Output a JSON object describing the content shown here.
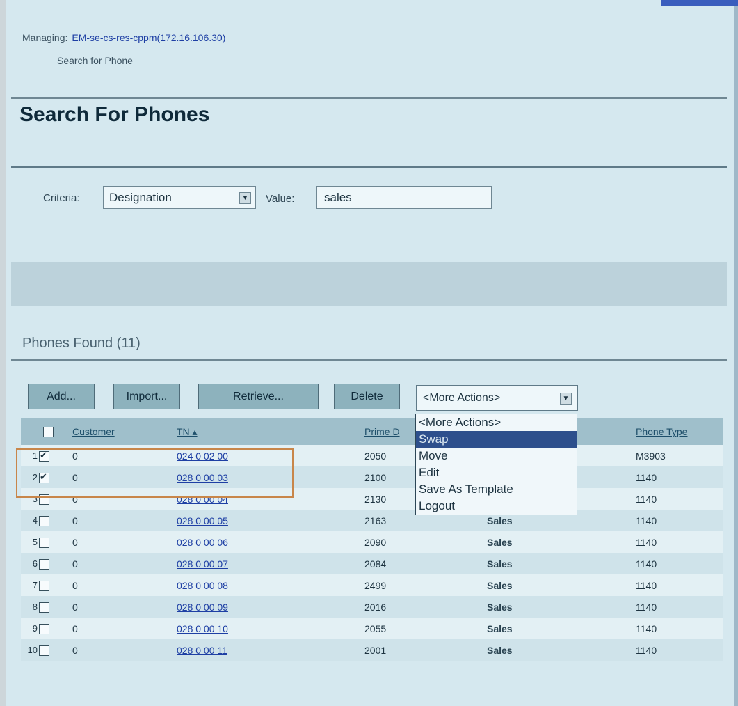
{
  "header": {
    "managing_label": "Managing:",
    "managing_link": "EM-se-cs-res-cppm(172.16.106.30)",
    "breadcrumb": "Search for Phone"
  },
  "page_title": "Search For Phones",
  "search": {
    "criteria_label": "Criteria:",
    "criteria_value": "Designation",
    "value_label": "Value:",
    "value": "sales"
  },
  "results": {
    "found_label": "Phones Found (11)"
  },
  "toolbar": {
    "add_label": "Add...",
    "import_label": "Import...",
    "retrieve_label": "Retrieve...",
    "delete_label": "Delete",
    "more_actions_value": "<More Actions>",
    "more_actions_options": [
      "<More Actions>",
      "Swap",
      "Move",
      "Edit",
      "Save As Template",
      "Logout"
    ],
    "highlighted_option": "Swap"
  },
  "table": {
    "columns": {
      "customer": "Customer",
      "tn": "TN ▴",
      "prime_dn": "Prime D",
      "phone_type": "Phone Type"
    },
    "rows": [
      {
        "num": "1",
        "checked": true,
        "customer": "0",
        "tn": "024 0 02 00",
        "prime_dn": "2050",
        "designation": "",
        "phone_type": "M3903"
      },
      {
        "num": "2",
        "checked": true,
        "customer": "0",
        "tn": "028 0 00 03",
        "prime_dn": "2100",
        "designation": "",
        "phone_type": "1140"
      },
      {
        "num": "3",
        "checked": false,
        "customer": "0",
        "tn": "028 0 00 04",
        "prime_dn": "2130",
        "designation": "",
        "phone_type": "1140"
      },
      {
        "num": "4",
        "checked": false,
        "customer": "0",
        "tn": "028 0 00 05",
        "prime_dn": "2163",
        "designation": "Sales",
        "phone_type": "1140"
      },
      {
        "num": "5",
        "checked": false,
        "customer": "0",
        "tn": "028 0 00 06",
        "prime_dn": "2090",
        "designation": "Sales",
        "phone_type": "1140"
      },
      {
        "num": "6",
        "checked": false,
        "customer": "0",
        "tn": "028 0 00 07",
        "prime_dn": "2084",
        "designation": "Sales",
        "phone_type": "1140"
      },
      {
        "num": "7",
        "checked": false,
        "customer": "0",
        "tn": "028 0 00 08",
        "prime_dn": "2499",
        "designation": "Sales",
        "phone_type": "1140"
      },
      {
        "num": "8",
        "checked": false,
        "customer": "0",
        "tn": "028 0 00 09",
        "prime_dn": "2016",
        "designation": "Sales",
        "phone_type": "1140"
      },
      {
        "num": "9",
        "checked": false,
        "customer": "0",
        "tn": "028 0 00 10",
        "prime_dn": "2055",
        "designation": "Sales",
        "phone_type": "1140"
      },
      {
        "num": "10",
        "checked": false,
        "customer": "0",
        "tn": "028 0 00 11",
        "prime_dn": "2001",
        "designation": "Sales",
        "phone_type": "1140"
      }
    ]
  }
}
